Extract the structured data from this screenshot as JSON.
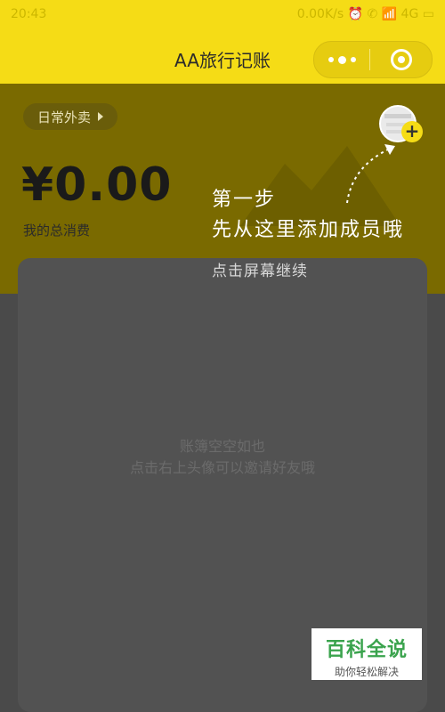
{
  "status_bar": {
    "time": "20:43",
    "right": "0.00K/s  ⏰  ✆  📶  4G  ▭"
  },
  "navbar": {
    "title": "AA旅行记账"
  },
  "header": {
    "chip_label": "日常外卖",
    "amount": "¥0.00",
    "amount_label": "我的总消费"
  },
  "guide": {
    "step_title": "第一步",
    "step_text": "先从这里添加成员哦",
    "tap_hint": "点击屏幕继续"
  },
  "content": {
    "empty_line1": "账簿空空如也",
    "empty_line2": "点击右上头像可以邀请好友哦"
  },
  "watermark": {
    "title": "百科全说",
    "subtitle": "助你轻松解决"
  },
  "colors": {
    "brand_yellow": "#f5dc16",
    "header_dark": "#7a6a00",
    "overlay": "#4a4a4a"
  }
}
